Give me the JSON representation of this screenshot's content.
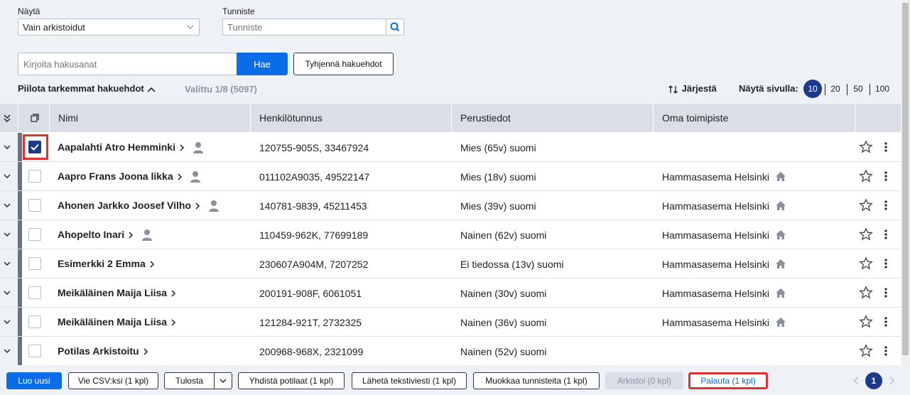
{
  "filters": {
    "show_label": "Näytä",
    "show_value": "Vain arkistoidut",
    "id_label": "Tunniste",
    "id_placeholder": "Tunniste",
    "search_placeholder": "Kirjoita hakusanat",
    "search_button": "Hae",
    "clear_button": "Tyhjennä hakuehdot",
    "hide_advanced": "Piilota tarkemmat hakuehdot",
    "selected_info": "Valittu 1/8 (5097)",
    "sort_label": "Järjestä",
    "per_page_label": "Näytä sivulla:",
    "per_page_options": [
      "10",
      "20",
      "50",
      "100"
    ],
    "per_page_selected": "10"
  },
  "table": {
    "columns": [
      "Nimi",
      "Henkilötunnus",
      "Perustiedot",
      "Oma toimipiste"
    ],
    "rows": [
      {
        "name": "Aapalahti Atro Hemminki",
        "id": "120755-905S, 33467924",
        "info": "Mies (65v) suomi",
        "office": "",
        "checked": true,
        "person_icon": true
      },
      {
        "name": "Aapro Frans Joona likka",
        "id": "011102A9035, 49522147",
        "info": "Mies (18v) suomi",
        "office": "Hammasasema Helsinki",
        "checked": false,
        "person_icon": true
      },
      {
        "name": "Ahonen Jarkko Joosef Vilho",
        "id": "140781-9839, 45211453",
        "info": "Mies (39v) suomi",
        "office": "Hammasasema Helsinki",
        "checked": false,
        "person_icon": true
      },
      {
        "name": "Ahopelto Inari",
        "id": "110459-962K, 77699189",
        "info": "Nainen (62v) suomi",
        "office": "Hammasasema Helsinki",
        "checked": false,
        "person_icon": true
      },
      {
        "name": "Esimerkki 2 Emma",
        "id": "230607A904M, 7207252",
        "info": "Ei tiedossa (13v) suomi",
        "office": "Hammasasema Helsinki",
        "checked": false,
        "person_icon": false
      },
      {
        "name": "Meikäläinen Maija Liisa",
        "id": "200191-908F, 6061051",
        "info": "Nainen (30v) suomi",
        "office": "Hammasasema Helsinki",
        "checked": false,
        "person_icon": false
      },
      {
        "name": "Meikäläinen Maija Liisa",
        "id": "121284-921T, 2732325",
        "info": "Nainen (36v) suomi",
        "office": "Hammasasema Helsinki",
        "checked": false,
        "person_icon": false
      },
      {
        "name": "Potilas Arkistoitu",
        "id": "200968-968X, 2321099",
        "info": "Nainen (52v) suomi",
        "office": "",
        "checked": false,
        "person_icon": false
      }
    ]
  },
  "footer": {
    "new": "Luo uusi",
    "csv": "Vie CSV:ksi (1 kpl)",
    "print": "Tulosta",
    "merge": "Yhdistä potilaat (1 kpl)",
    "sms": "Lähetä tekstiviesti (1 kpl)",
    "edit_ids": "Muokkaa tunnisteita (1 kpl)",
    "archive": "Arkistoi (0 kpl)",
    "restore": "Palauta (1 kpl)",
    "page": "1"
  },
  "colors": {
    "primary": "#0a6ce6",
    "navy": "#1b3a8c",
    "highlight": "#e03131"
  }
}
